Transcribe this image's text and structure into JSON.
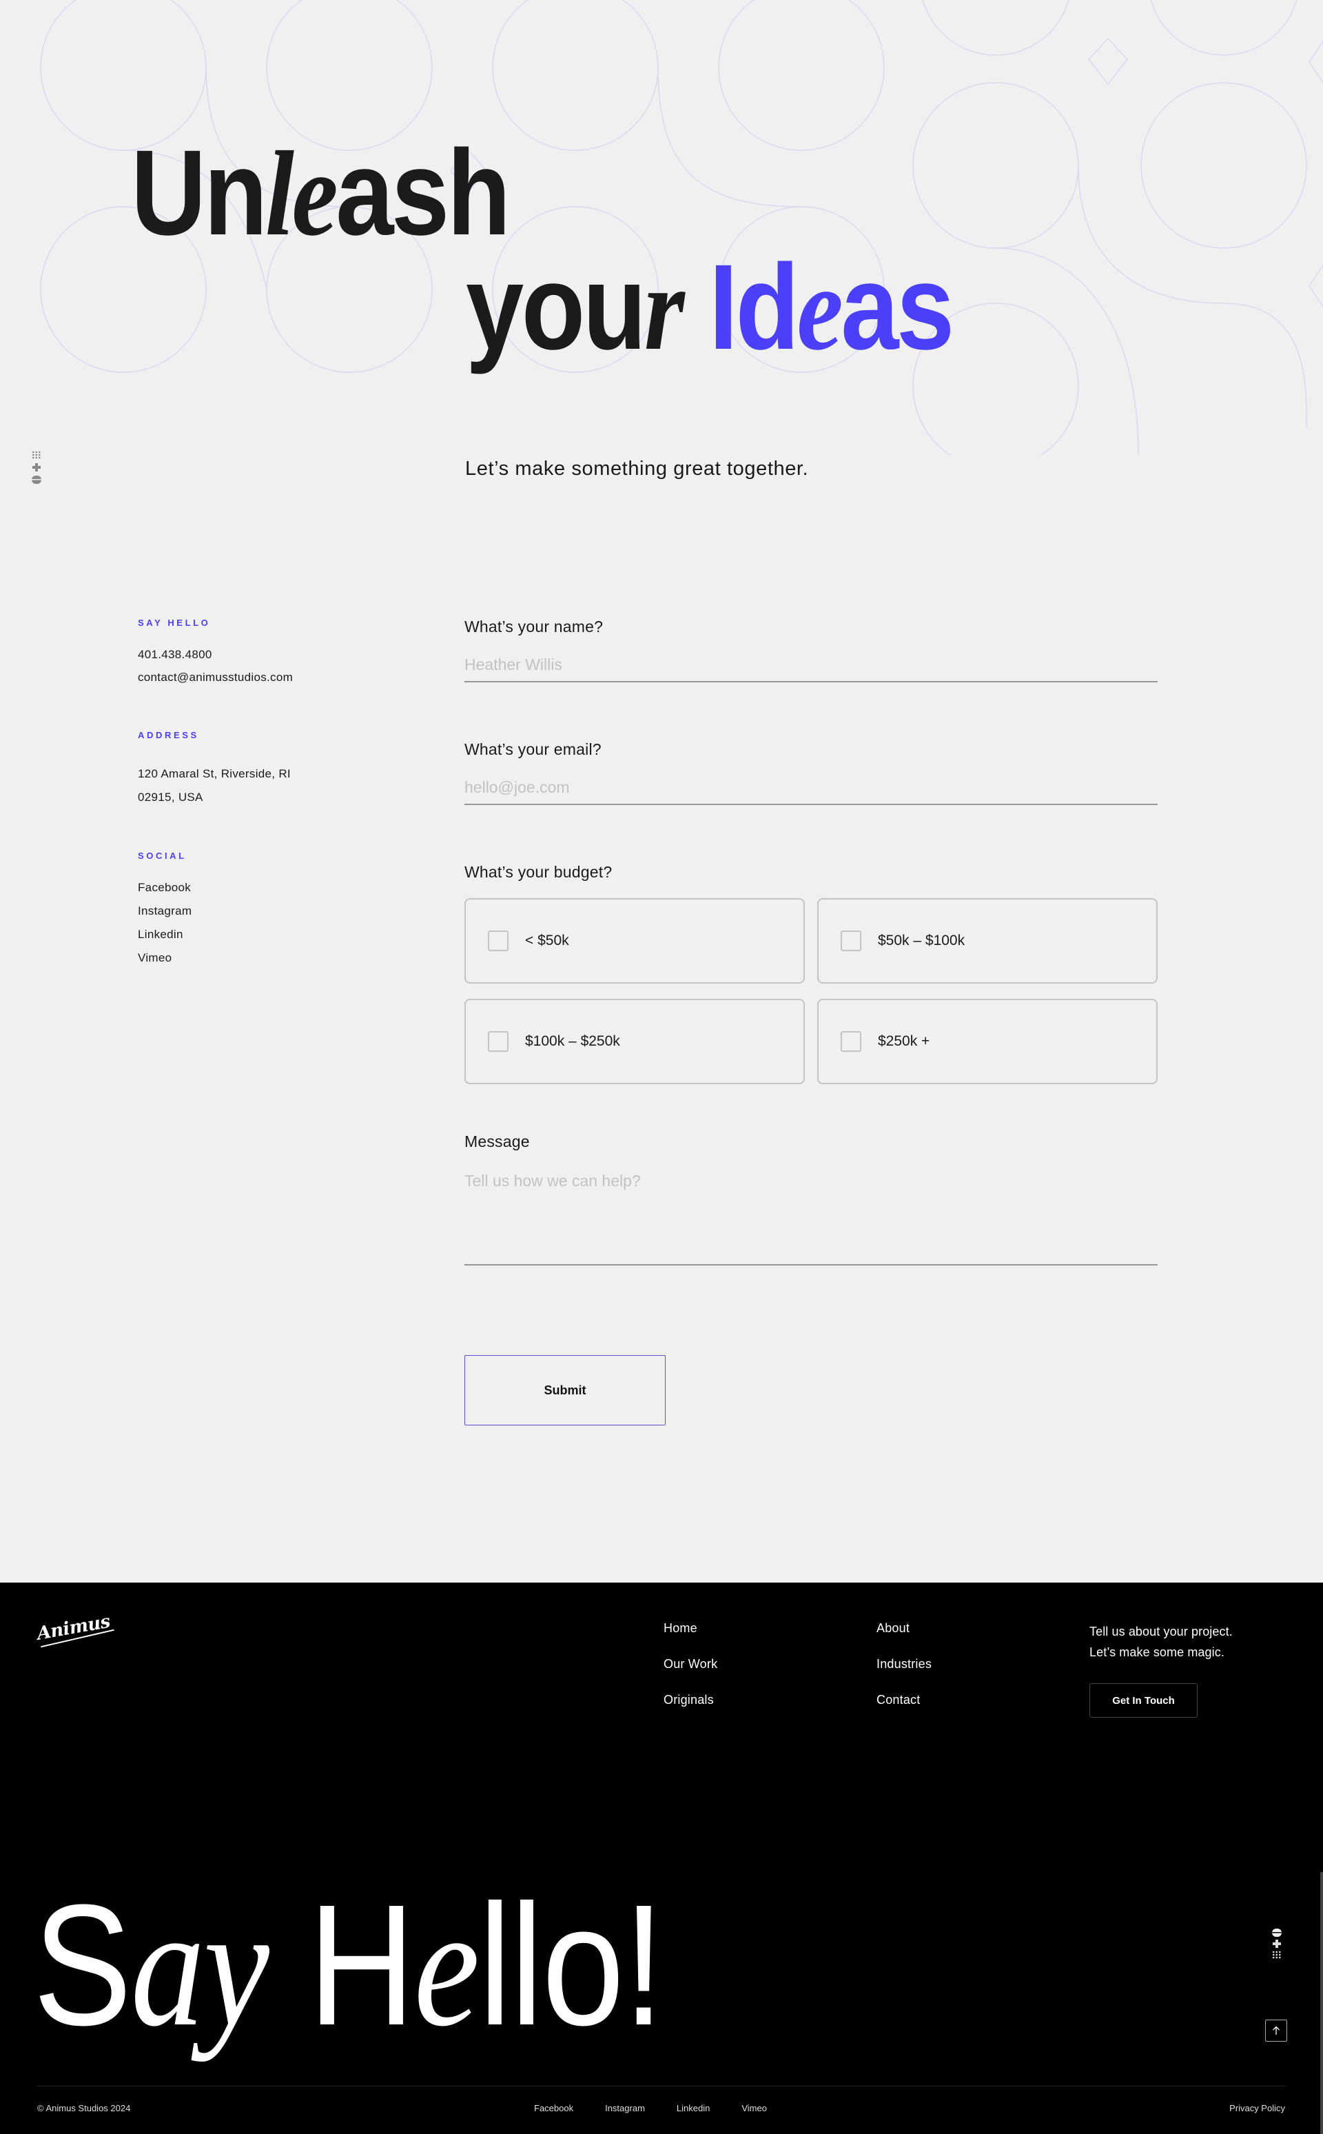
{
  "hero": {
    "line1_part1": "Un",
    "line1_italic": "l",
    "line1_part2": "e",
    "line1_part3": "ash",
    "line2_your_part1": "you",
    "line2_your_italic": "r",
    "line2_ideas_part1": "Id",
    "line2_ideas_italic": "e",
    "line2_ideas_part2": "as",
    "tagline": "Let’s make something great together.",
    "accent_color": "#4b3ff7"
  },
  "contact_info": {
    "say_hello": {
      "label": "SAY HELLO",
      "phone": "401.438.4800",
      "email": "contact@animusstudios.com"
    },
    "address": {
      "label": "ADDRESS",
      "line1": "120 Amaral St, Riverside, RI",
      "line2": "02915, USA"
    },
    "social": {
      "label": "SOCIAL",
      "links": [
        "Facebook",
        "Instagram",
        "Linkedin",
        "Vimeo"
      ]
    }
  },
  "form": {
    "name": {
      "label": "What’s your name?",
      "placeholder": "Heather Willis",
      "value": ""
    },
    "email": {
      "label": "What’s your email?",
      "placeholder": "hello@joe.com",
      "value": ""
    },
    "budget": {
      "label": "What’s your budget?",
      "options": [
        {
          "label": "< $50k",
          "checked": false
        },
        {
          "label": "$50k – $100k",
          "checked": false
        },
        {
          "label": "$100k – $250k",
          "checked": false
        },
        {
          "label": "$250k +",
          "checked": false
        }
      ]
    },
    "message": {
      "label": "Message",
      "placeholder": "Tell us how we can help?",
      "value": ""
    },
    "submit_label": "Submit"
  },
  "footer": {
    "logo_text": "Animus",
    "nav_col1": [
      "Home",
      "Our Work",
      "Originals"
    ],
    "nav_col2": [
      "About",
      "Industries",
      "Contact"
    ],
    "cta_line1": "Tell us about your project.",
    "cta_line2": "Let’s make some magic.",
    "cta_button": "Get In Touch",
    "big_text_part1": "S",
    "big_text_italic": "ay",
    "big_text_part2": " H",
    "big_text_italic2": "e",
    "big_text_part3": "llo!",
    "scroll_top_icon": "arrow-up-icon",
    "copyright": "© Animus Studios 2024",
    "bottom_links": [
      "Facebook",
      "Instagram",
      "Linkedin",
      "Vimeo"
    ],
    "privacy": "Privacy Policy"
  },
  "side_widget_icons": [
    "grid-icon",
    "plus-icon",
    "stack-icon"
  ]
}
